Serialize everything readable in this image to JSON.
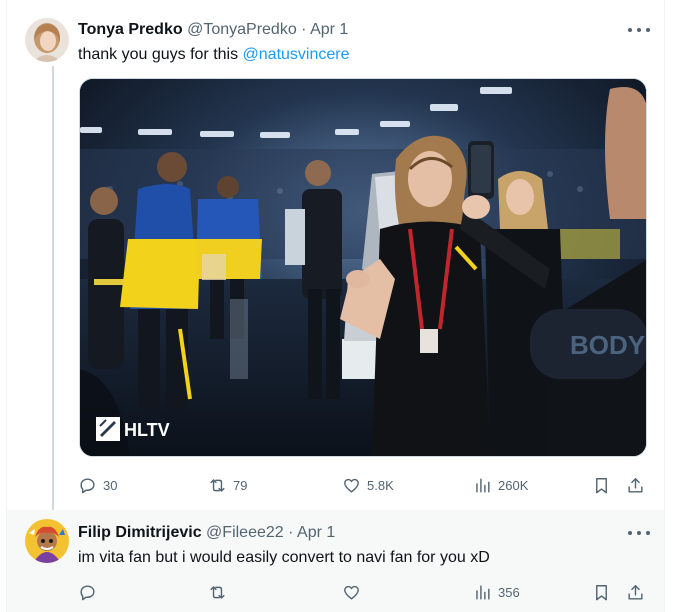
{
  "tweets": [
    {
      "author_name": "Tonya Predko",
      "handle": "@TonyaPredko",
      "separator": "·",
      "date": "Apr 1",
      "text_prefix": "thank you guys for this ",
      "mention": "@natusvincere",
      "media": {
        "watermark": "HLTV",
        "banner_text": "BODY"
      },
      "stats": {
        "replies": "30",
        "reposts": "79",
        "likes": "5.8K",
        "views": "260K"
      }
    },
    {
      "author_name": "Filip Dimitrijevic",
      "handle": "@Fileee22",
      "separator": "·",
      "date": "Apr 1",
      "text": "im vita fan but i would easily convert to navi fan for you xD",
      "stats": {
        "views": "356"
      }
    }
  ],
  "icons": {
    "reply": "reply-icon",
    "repost": "repost-icon",
    "like": "heart-icon",
    "views": "analytics-icon",
    "bookmark": "bookmark-icon",
    "share": "share-icon",
    "more": "more-dots-icon"
  },
  "colors": {
    "link": "#1d9bf0",
    "text": "#0f1419",
    "secondary": "#536471",
    "thread_line": "#cfd9de",
    "reply_bg": "#f7f9f9",
    "flag_blue": "#1f4fa8",
    "flag_yellow": "#f3d21b"
  }
}
